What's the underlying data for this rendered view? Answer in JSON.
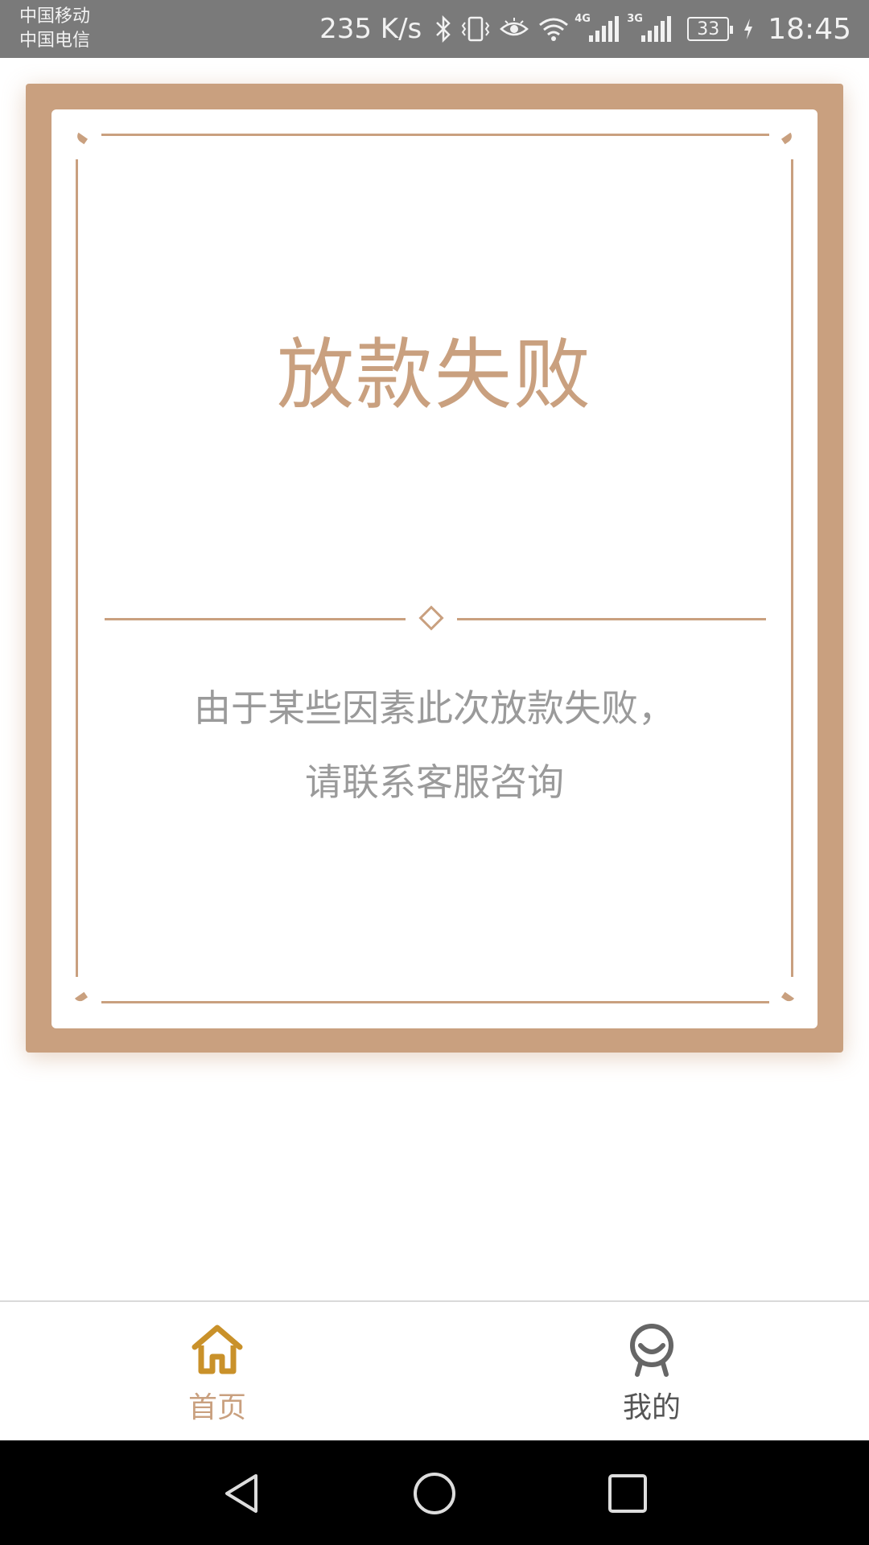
{
  "status_bar": {
    "carrier_1": "中国移动",
    "carrier_2": "中国电信",
    "net_speed": "235 K/s",
    "signal_1_tag": "4G",
    "signal_2_tag": "3G",
    "battery": "33",
    "time": "18:45",
    "icons": [
      "bluetooth-icon",
      "vibrate-icon",
      "eye-icon",
      "wifi-icon",
      "signal-icon",
      "battery-icon",
      "charging-icon"
    ]
  },
  "card": {
    "title": "放款失败",
    "message_line_1": "由于某些因素此次放款失败，",
    "message_line_2": "请联系客服咨询"
  },
  "bottom_nav": {
    "items": [
      {
        "label": "首页",
        "icon": "home-icon",
        "active": true
      },
      {
        "label": "我的",
        "icon": "profile-icon",
        "active": false
      }
    ]
  },
  "system_nav": {
    "icons": [
      "back-icon",
      "home-circle-icon",
      "recents-icon"
    ]
  },
  "colors": {
    "accent": "#c9a07f",
    "nav_active": "#c9912a",
    "text_muted": "#9a9a9a",
    "status_bar": "#7a7a7a"
  }
}
